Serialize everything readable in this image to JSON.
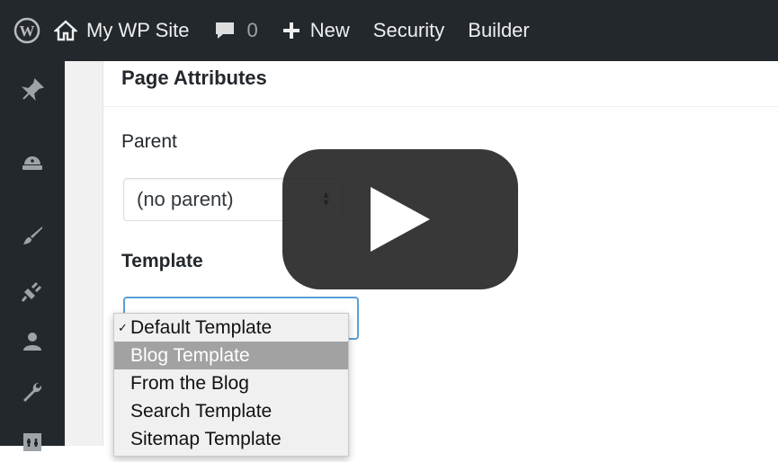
{
  "adminbar": {
    "site_name": "My WP Site",
    "comments_count": "0",
    "new_label": "New",
    "security_label": "Security",
    "builder_label": "Builder",
    "icons": [
      "wordpress-logo-icon",
      "home-icon",
      "comment-icon",
      "plus-icon"
    ]
  },
  "sidebar": {
    "icons": [
      "pin-icon",
      "helmet-icon",
      "brush-icon",
      "plugin-icon",
      "user-icon",
      "wrench-icon",
      "settings-icon"
    ]
  },
  "panel": {
    "title": "Page Attributes",
    "parent_label": "Parent",
    "parent_value": "(no parent)",
    "template_label": "Template"
  },
  "template_dropdown": {
    "checked_index": 0,
    "highlighted_index": 1,
    "options": [
      "Default Template",
      "Blog Template",
      "From the Blog",
      "Search Template",
      "Sitemap Template"
    ]
  },
  "video": {
    "overlay": "play-button"
  },
  "colors": {
    "adminbar_bg": "#23282d",
    "focus_border": "#5b9dd9",
    "highlight": "#a2a2a2"
  }
}
